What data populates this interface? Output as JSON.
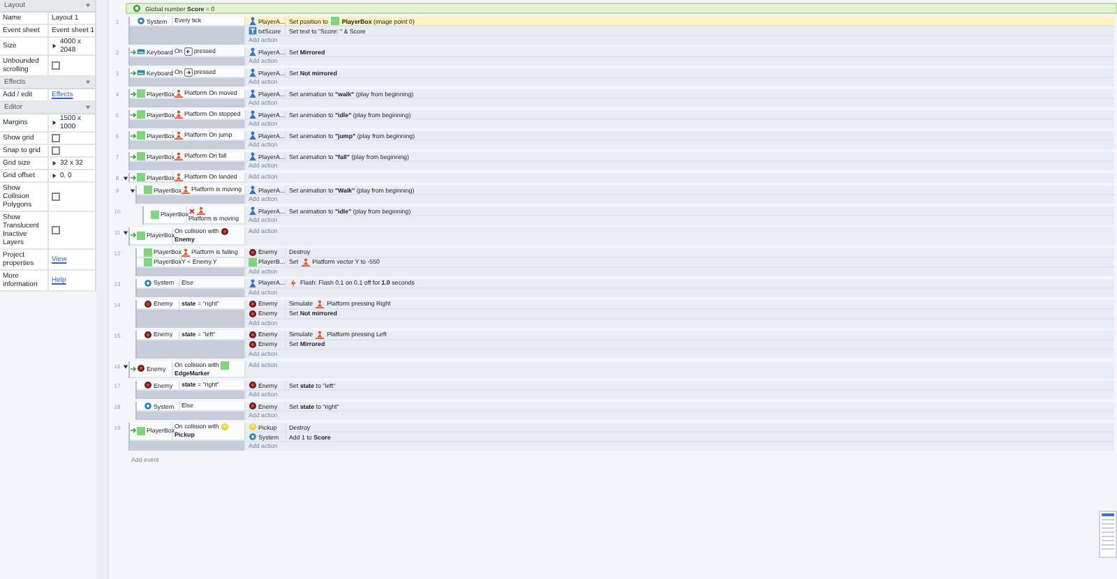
{
  "properties": {
    "sections": [
      {
        "title": "Layout",
        "rows": [
          {
            "kind": "text",
            "label": "Name",
            "value": "Layout 1"
          },
          {
            "kind": "select",
            "label": "Event sheet",
            "value": "Event sheet 1"
          },
          {
            "kind": "expand",
            "label": "Size",
            "value": "4000 x 2048"
          },
          {
            "kind": "checkbox",
            "label": "Unbounded scrolling",
            "checked": false
          }
        ]
      },
      {
        "title": "Effects",
        "rows": [
          {
            "kind": "link",
            "label": "Add / edit",
            "value": "Effects"
          }
        ]
      },
      {
        "title": "Editor",
        "rows": [
          {
            "kind": "expand",
            "label": "Margins",
            "value": "1500 x 1000"
          },
          {
            "kind": "checkbox",
            "label": "Show grid",
            "checked": false
          },
          {
            "kind": "checkbox",
            "label": "Snap to grid",
            "checked": false
          },
          {
            "kind": "expand",
            "label": "Grid size",
            "value": "32 x 32"
          },
          {
            "kind": "expand",
            "label": "Grid offset",
            "value": "0, 0"
          },
          {
            "kind": "checkbox",
            "label": "Show Collision Polygons",
            "checked": false
          },
          {
            "kind": "checkbox",
            "label": "Show Translucent Inactive Layers",
            "checked": false
          }
        ]
      }
    ],
    "footer": [
      {
        "kind": "link",
        "label": "Project properties",
        "value": "View"
      },
      {
        "kind": "link",
        "label": "More information",
        "value": "Help"
      }
    ]
  },
  "event_sheet": {
    "global_variable": "Global number **Score** = 0",
    "events": [
      {
        "number": "1",
        "trigger": false,
        "conditions": [
          {
            "kind": "system",
            "object": "System",
            "parts": [
              {
                "kind": "text",
                "text": "Every tick"
              }
            ]
          }
        ],
        "actions": [
          {
            "kind": "player",
            "object": "PlayerA...",
            "selected": true,
            "parts": [
              {
                "kind": "text",
                "text": "Set position to"
              },
              {
                "kind": "sprite"
              },
              {
                "kind": "text",
                "text": "**PlayerBox** (image point 0)"
              }
            ]
          },
          {
            "kind": "textobj",
            "object": "txtScore",
            "selected": false,
            "parts": [
              {
                "kind": "text",
                "text": "Set text to \"Score: \" & Score"
              }
            ]
          }
        ],
        "add_action": "Add action"
      },
      {
        "number": "2",
        "trigger": true,
        "conditions": [
          {
            "kind": "keyboard",
            "object": "Keyboard",
            "parts": [
              {
                "kind": "text",
                "text": "On"
              },
              {
                "kind": "key-left"
              },
              {
                "kind": "text",
                "text": "pressed"
              }
            ]
          }
        ],
        "actions": [
          {
            "kind": "player",
            "object": "PlayerA...",
            "selected": false,
            "parts": [
              {
                "kind": "text",
                "text": "Set **Mirrored**"
              }
            ]
          }
        ],
        "add_action": "Add action"
      },
      {
        "number": "3",
        "trigger": true,
        "conditions": [
          {
            "kind": "keyboard",
            "object": "Keyboard",
            "parts": [
              {
                "kind": "text",
                "text": "On"
              },
              {
                "kind": "key-right"
              },
              {
                "kind": "text",
                "text": "pressed"
              }
            ]
          }
        ],
        "actions": [
          {
            "kind": "player",
            "object": "PlayerA...",
            "selected": false,
            "parts": [
              {
                "kind": "text",
                "text": "Set **Not mirrored**"
              }
            ]
          }
        ],
        "add_action": "Add action"
      },
      {
        "number": "4",
        "trigger": true,
        "conditions": [
          {
            "kind": "sprite",
            "object": "PlayerBox",
            "parts": [
              {
                "kind": "platform"
              },
              {
                "kind": "text",
                "text": "Platform On moved"
              }
            ]
          }
        ],
        "actions": [
          {
            "kind": "player",
            "object": "PlayerA...",
            "selected": false,
            "parts": [
              {
                "kind": "text",
                "text": "Set animation to **\"walk\"** (play from beginning)"
              }
            ]
          }
        ],
        "add_action": "Add action"
      },
      {
        "number": "5",
        "trigger": true,
        "conditions": [
          {
            "kind": "sprite",
            "object": "PlayerBox",
            "parts": [
              {
                "kind": "platform"
              },
              {
                "kind": "text",
                "text": "Platform On stopped"
              }
            ]
          }
        ],
        "actions": [
          {
            "kind": "player",
            "object": "PlayerA...",
            "selected": false,
            "parts": [
              {
                "kind": "text",
                "text": "Set animation to **\"idle\"** (play from beginning)"
              }
            ]
          }
        ],
        "add_action": "Add action"
      },
      {
        "number": "6",
        "trigger": true,
        "conditions": [
          {
            "kind": "sprite",
            "object": "PlayerBox",
            "parts": [
              {
                "kind": "platform"
              },
              {
                "kind": "text",
                "text": "Platform On jump"
              }
            ]
          }
        ],
        "actions": [
          {
            "kind": "player",
            "object": "PlayerA...",
            "selected": false,
            "parts": [
              {
                "kind": "text",
                "text": "Set animation to **\"jump\"** (play from beginning)"
              }
            ]
          }
        ],
        "add_action": "Add action"
      },
      {
        "number": "7",
        "trigger": true,
        "conditions": [
          {
            "kind": "sprite",
            "object": "PlayerBox",
            "parts": [
              {
                "kind": "platform"
              },
              {
                "kind": "text",
                "text": "Platform On fall"
              }
            ]
          }
        ],
        "actions": [
          {
            "kind": "player",
            "object": "PlayerA...",
            "selected": false,
            "parts": [
              {
                "kind": "text",
                "text": "Set animation to **\"fall\"** (play from beginning)"
              }
            ]
          }
        ],
        "add_action": "Add action"
      },
      {
        "number": "8",
        "trigger": true,
        "expanded": true,
        "conditions": [
          {
            "kind": "sprite",
            "object": "PlayerBox",
            "parts": [
              {
                "kind": "platform"
              },
              {
                "kind": "text",
                "text": "Platform On landed"
              }
            ]
          }
        ],
        "add_action": "Add action",
        "children": [
          {
            "number": "9",
            "trigger": false,
            "expanded": true,
            "conditions": [
              {
                "kind": "sprite",
                "object": "PlayerBox",
                "parts": [
                  {
                    "kind": "platform"
                  },
                  {
                    "kind": "text",
                    "text": "Platform is moving"
                  }
                ]
              }
            ],
            "actions": [
              {
                "kind": "player",
                "object": "PlayerA...",
                "selected": false,
                "parts": [
                  {
                    "kind": "text",
                    "text": "Set animation to **\"Walk\"** (play from beginning)"
                  }
                ]
              }
            ],
            "add_action": "Add action",
            "children": [
              {
                "number": "10",
                "trigger": false,
                "conditions": [
                  {
                    "kind": "sprite",
                    "object": "PlayerBox",
                    "inverted": true,
                    "parts": [
                      {
                        "kind": "platform"
                      },
                      {
                        "kind": "text",
                        "text": "Platform is moving"
                      }
                    ]
                  }
                ],
                "actions": [
                  {
                    "kind": "player",
                    "object": "PlayerA...",
                    "selected": false,
                    "parts": [
                      {
                        "kind": "text",
                        "text": "Set animation to **\"idle\"** (play from beginning)"
                      }
                    ]
                  }
                ],
                "add_action": "Add action"
              }
            ]
          }
        ]
      },
      {
        "number": "11",
        "trigger": true,
        "expanded": true,
        "conditions": [
          {
            "kind": "sprite",
            "object": "PlayerBox",
            "parts": [
              {
                "kind": "text",
                "text": "On collision with"
              },
              {
                "kind": "enemy"
              },
              {
                "kind": "text",
                "text": "**Enemy**"
              }
            ]
          }
        ],
        "add_action": "Add action",
        "children": [
          {
            "number": "12",
            "trigger": false,
            "conditions": [
              {
                "kind": "sprite",
                "object": "PlayerBox",
                "parts": [
                  {
                    "kind": "platform"
                  },
                  {
                    "kind": "text",
                    "text": "Platform is falling"
                  }
                ]
              },
              {
                "kind": "sprite",
                "object": "PlayerBox",
                "parts": [
                  {
                    "kind": "text",
                    "text": "Y < Enemy.Y"
                  }
                ]
              }
            ],
            "actions": [
              {
                "kind": "enemy",
                "object": "Enemy",
                "selected": false,
                "parts": [
                  {
                    "kind": "text",
                    "text": "Destroy"
                  }
                ]
              },
              {
                "kind": "sprite",
                "object": "PlayerB...",
                "selected": false,
                "parts": [
                  {
                    "kind": "text",
                    "text": "Set"
                  },
                  {
                    "kind": "platform"
                  },
                  {
                    "kind": "text",
                    "text": "Platform vector Y to -550"
                  }
                ]
              }
            ],
            "add_action": "Add action"
          },
          {
            "number": "13",
            "trigger": false,
            "conditions": [
              {
                "kind": "system",
                "object": "System",
                "parts": [
                  {
                    "kind": "text",
                    "text": "Else"
                  }
                ]
              }
            ],
            "actions": [
              {
                "kind": "player",
                "object": "PlayerA...",
                "selected": false,
                "parts": [
                  {
                    "kind": "flash"
                  },
                  {
                    "kind": "text",
                    "text": "Flash: Flash 0.1 on 0.1 off for **1.0** seconds"
                  }
                ]
              }
            ],
            "add_action": "Add action"
          },
          {
            "number": "14",
            "trigger": false,
            "conditions": [
              {
                "kind": "enemy",
                "object": "Enemy",
                "parts": [
                  {
                    "kind": "text",
                    "text": "**state** = \"right\""
                  }
                ]
              }
            ],
            "actions": [
              {
                "kind": "enemy",
                "object": "Enemy",
                "selected": false,
                "parts": [
                  {
                    "kind": "text",
                    "text": "Simulate"
                  },
                  {
                    "kind": "platform"
                  },
                  {
                    "kind": "text",
                    "text": "Platform pressing Right"
                  }
                ]
              },
              {
                "kind": "enemy",
                "object": "Enemy",
                "selected": false,
                "parts": [
                  {
                    "kind": "text",
                    "text": "Set **Not mirrored**"
                  }
                ]
              }
            ],
            "add_action": "Add action"
          },
          {
            "number": "15",
            "trigger": false,
            "conditions": [
              {
                "kind": "enemy",
                "object": "Enemy",
                "parts": [
                  {
                    "kind": "text",
                    "text": "**state** = \"left\""
                  }
                ]
              }
            ],
            "actions": [
              {
                "kind": "enemy",
                "object": "Enemy",
                "selected": false,
                "parts": [
                  {
                    "kind": "text",
                    "text": "Simulate"
                  },
                  {
                    "kind": "platform"
                  },
                  {
                    "kind": "text",
                    "text": "Platform pressing Left"
                  }
                ]
              },
              {
                "kind": "enemy",
                "object": "Enemy",
                "selected": false,
                "parts": [
                  {
                    "kind": "text",
                    "text": "Set **Mirrored**"
                  }
                ]
              }
            ],
            "add_action": "Add action"
          }
        ]
      },
      {
        "number": "16",
        "trigger": true,
        "expanded": true,
        "conditions": [
          {
            "kind": "enemy",
            "object": "Enemy",
            "parts": [
              {
                "kind": "text",
                "text": "On collision with"
              },
              {
                "kind": "sprite"
              },
              {
                "kind": "text",
                "text": "**EdgeMarker**"
              }
            ]
          }
        ],
        "add_action": "Add action",
        "children": [
          {
            "number": "17",
            "trigger": false,
            "conditions": [
              {
                "kind": "enemy",
                "object": "Enemy",
                "parts": [
                  {
                    "kind": "text",
                    "text": "**state** = \"right\""
                  }
                ]
              }
            ],
            "actions": [
              {
                "kind": "enemy",
                "object": "Enemy",
                "selected": false,
                "parts": [
                  {
                    "kind": "text",
                    "text": "Set **state** to \"left\""
                  }
                ]
              }
            ],
            "add_action": "Add action"
          },
          {
            "number": "18",
            "trigger": false,
            "conditions": [
              {
                "kind": "system",
                "object": "System",
                "parts": [
                  {
                    "kind": "text",
                    "text": "Else"
                  }
                ]
              }
            ],
            "actions": [
              {
                "kind": "enemy",
                "object": "Enemy",
                "selected": false,
                "parts": [
                  {
                    "kind": "text",
                    "text": "Set **state** to \"right\""
                  }
                ]
              }
            ],
            "add_action": "Add action"
          }
        ]
      },
      {
        "number": "19",
        "trigger": true,
        "conditions": [
          {
            "kind": "sprite",
            "object": "PlayerBox",
            "parts": [
              {
                "kind": "text",
                "text": "On collision with"
              },
              {
                "kind": "pickup"
              },
              {
                "kind": "text",
                "text": "**Pickup**"
              }
            ]
          }
        ],
        "actions": [
          {
            "kind": "pickup",
            "object": "Pickup",
            "selected": false,
            "parts": [
              {
                "kind": "text",
                "text": "Destroy"
              }
            ]
          },
          {
            "kind": "system",
            "object": "System",
            "selected": false,
            "parts": [
              {
                "kind": "text",
                "text": "Add 1 to **Score**"
              }
            ]
          }
        ],
        "add_action": "Add action"
      }
    ],
    "add_event": "Add event"
  }
}
